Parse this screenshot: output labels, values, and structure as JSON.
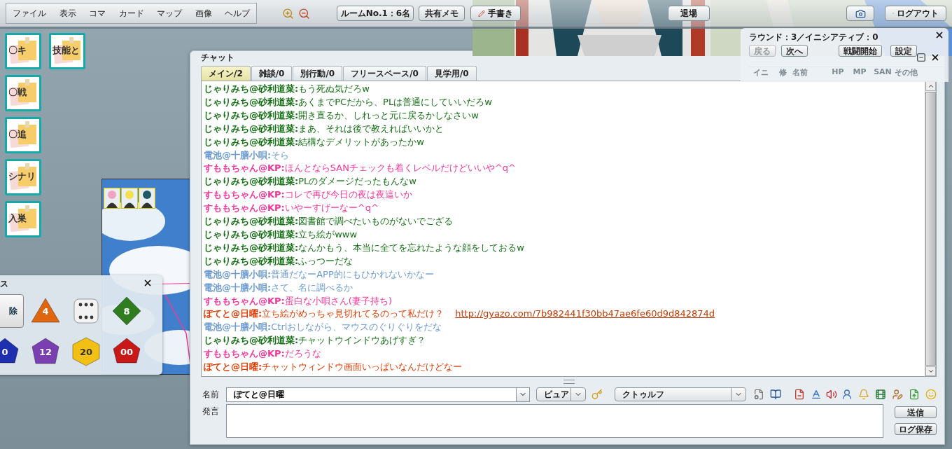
{
  "toolbar": {
    "menu": [
      "ファイル",
      "表示",
      "コマ",
      "カード",
      "マップ",
      "画像",
      "ヘルプ"
    ],
    "room_button": "ルームNo.1：6名",
    "memo_button": "共有メモ",
    "draw_button": "手書き",
    "exit_button": "退場",
    "logout_button": "ログアウト"
  },
  "cards": [
    {
      "label": "〇キ"
    },
    {
      "label": "技能と"
    },
    {
      "label": "〇戦"
    },
    {
      "label": "〇追"
    },
    {
      "label": "シナリ"
    },
    {
      "label": "入巣"
    }
  ],
  "map": {
    "tokens": [
      {
        "color": "#f2a3c4"
      },
      {
        "color": "#f5e04a"
      },
      {
        "color": "#1f5a66"
      }
    ]
  },
  "dice_window": {
    "title": "ス",
    "delete_button": "除",
    "dice": [
      {
        "kind": "d4",
        "label": "4",
        "color": "#e0650f"
      },
      {
        "kind": "d6",
        "color": "#f2f2f2"
      },
      {
        "kind": "d8",
        "label": "8",
        "color": "#2f7d1e"
      },
      {
        "kind": "d10",
        "label": "0",
        "color": "#1e2fb0"
      },
      {
        "kind": "d12",
        "label": "12",
        "color": "#7a3fb0"
      },
      {
        "kind": "d20",
        "label": "20",
        "color": "#f2c014"
      },
      {
        "kind": "d100",
        "label": "00",
        "color": "#c81818"
      }
    ]
  },
  "initiative": {
    "title": "ラウンド：3／イニシアティブ：0",
    "buttons": [
      {
        "label": "戻る",
        "disabled": true
      },
      {
        "label": "次へ",
        "disabled": false
      },
      {
        "label": "戦闘開始",
        "disabled": false
      },
      {
        "label": "設定",
        "disabled": false
      }
    ],
    "columns": [
      "イニ",
      "修",
      "名前",
      "HP",
      "MP",
      "SAN",
      "その他"
    ]
  },
  "chat": {
    "title": "チャット",
    "tabs": [
      {
        "label": "メイン/2",
        "selected": true
      },
      {
        "label": "雑談/0",
        "selected": false
      },
      {
        "label": "別行動/0",
        "selected": false
      },
      {
        "label": "フリースペース/0",
        "selected": false
      },
      {
        "label": "見学用/0",
        "selected": false
      }
    ],
    "messages": [
      {
        "speaker": "じゃりみち@砂利道菜:",
        "text": "もう死ぬ気だろw",
        "color": "#157015"
      },
      {
        "speaker": "じゃりみち@砂利道菜:",
        "text": "あくまでPCだから、PLは普通にしていいだろw",
        "color": "#157015"
      },
      {
        "speaker": "じゃりみち@砂利道菜:",
        "text": "開き直るか、しれっと元に戻るかしなさいw",
        "color": "#157015"
      },
      {
        "speaker": "じゃりみち@砂利道菜:",
        "text": "まあ、それは後で教えればいいかと",
        "color": "#157015"
      },
      {
        "speaker": "じゃりみち@砂利道菜:",
        "text": "結構なデメリットがあったかw",
        "color": "#157015"
      },
      {
        "speaker": "電池@十膳小唄:",
        "text": "そら",
        "color": "#6b9bd1"
      },
      {
        "speaker": "すももちゃん@KP:",
        "text": "ほんとならSANチェックも着くレベルだけどいいや^q^",
        "color": "#f5359a"
      },
      {
        "speaker": "じゃりみち@砂利道菜:",
        "text": "PLのダメージだったもんなw",
        "color": "#157015"
      },
      {
        "speaker": "すももちゃん@KP:",
        "text": "コレで再び今日の夜は夜這いか",
        "color": "#f5359a"
      },
      {
        "speaker": "すももちゃん@KP:",
        "text": "いやーすげーなー^q^",
        "color": "#f5359a"
      },
      {
        "speaker": "じゃりみち@砂利道菜:",
        "text": "図書館で調べたいものがないでござる",
        "color": "#157015"
      },
      {
        "speaker": "じゃりみち@砂利道菜:",
        "text": "立ち絵がwww",
        "color": "#157015"
      },
      {
        "speaker": "じゃりみち@砂利道菜:",
        "text": "なんかもう、本当に全てを忘れたような顔をしておるw",
        "color": "#157015"
      },
      {
        "speaker": "じゃりみち@砂利道菜:",
        "text": "ふっつーだな",
        "color": "#157015"
      },
      {
        "speaker": "電池@十膳小唄:",
        "text": "普通だなーAPP的にもひかれないかなー",
        "color": "#6b9bd1"
      },
      {
        "speaker": "電池@十膳小唄:",
        "text": "さて、名に調べるか",
        "color": "#6b9bd1"
      },
      {
        "speaker": "すももちゃん@KP:",
        "text": "蛋白な小唄さん(妻子持ち)",
        "color": "#f5359a"
      },
      {
        "speaker": "ぽてと@日曜:",
        "text": "立ち絵がめっちゃ見切れてるのって私だけ？",
        "link": "http://gyazo.com/7b982441f30bb47ae6fe60d9d842874d",
        "color": "#e03c00"
      },
      {
        "speaker": "電池@十膳小唄:",
        "text": "Ctrlおしながら、マウスのぐりぐりをだな",
        "color": "#6b9bd1"
      },
      {
        "speaker": "じゃりみち@砂利道菜:",
        "text": "チャットウインドウあげすぎ？",
        "color": "#157015"
      },
      {
        "speaker": "すももちゃん@KP:",
        "text": "だろうな",
        "color": "#f5359a"
      },
      {
        "speaker": "ぽてと@日曜:",
        "text": "チャットウィンドウ画面いっぱいなんだけどなー",
        "color": "#e03c00"
      }
    ],
    "name_label": "名前",
    "name_value": "ぽてと@日曜",
    "color_select": "ピュア",
    "system_select": "クトゥルフ",
    "message_label": "発言",
    "send_button": "送信",
    "save_button": "ログ保存"
  }
}
